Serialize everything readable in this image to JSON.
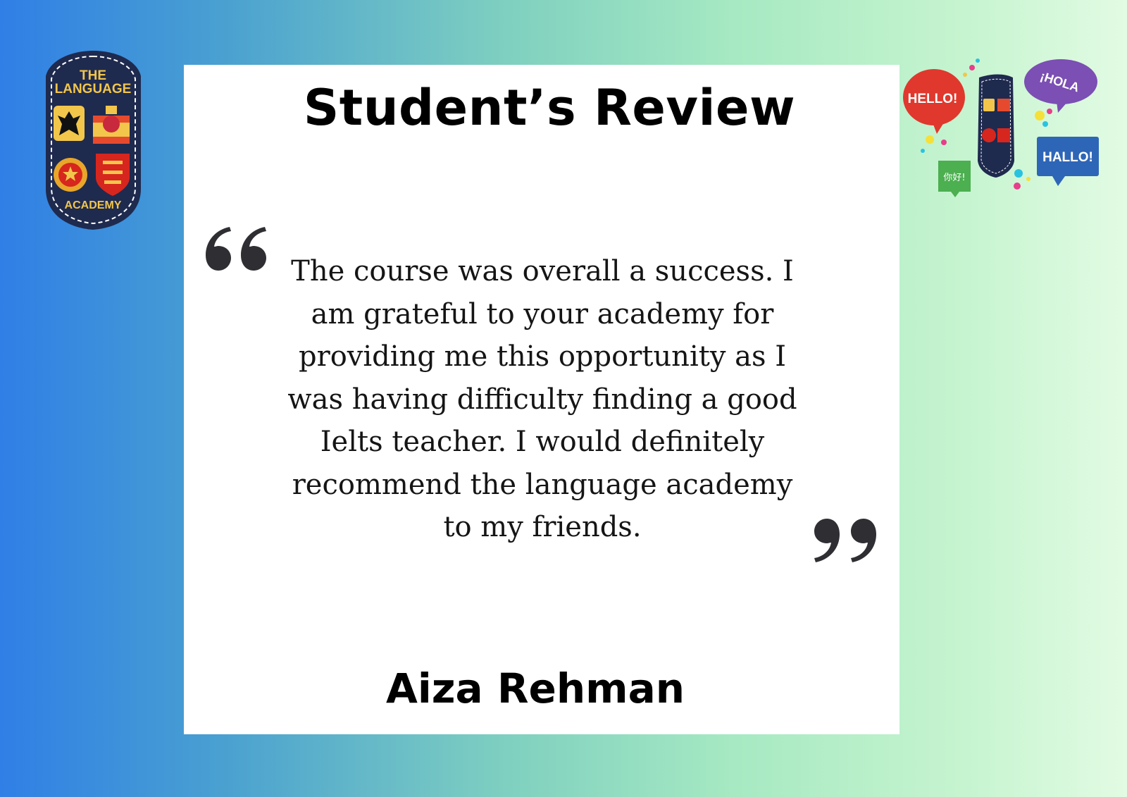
{
  "header": {
    "title": "Student’s Review"
  },
  "review": {
    "lines": [
      "The course was overall a success. I",
      "am grateful to your academy for",
      "providing me this opportunity as I",
      "was having difficulty finding a good",
      "Ielts teacher. I would definitely",
      "recommend the language academy",
      "to my friends."
    ]
  },
  "author": {
    "name": "Aiza Rehman"
  },
  "logo": {
    "line1": "THE",
    "line2": "LANGUAGE",
    "line3": "ACADEMY",
    "icon": "academy-crest-icon"
  },
  "speech_bubbles": {
    "hello": "HELLO!",
    "hola": "¡HOLA",
    "hallo": "HALLO!",
    "nihao": "你好!"
  },
  "colors": {
    "gradient_start": "#2f7fe6",
    "gradient_end": "#e2fbe3",
    "card": "#ffffff",
    "crest_navy": "#1f2a4f",
    "crest_gold": "#f2c64b",
    "hello_red": "#e0382d",
    "hola_purple": "#7b4fb3",
    "hallo_blue": "#2e66b7",
    "nihao_green": "#4caf50"
  }
}
